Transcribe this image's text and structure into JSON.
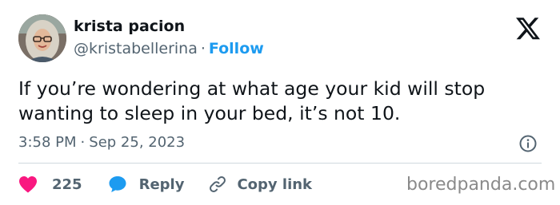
{
  "author": {
    "name": "krista pacion",
    "handle": "@kristabellerina",
    "follow_label": "Follow"
  },
  "tweet": {
    "text": "If you’re wondering at what age your kid will stop wanting to sleep in your bed, it’s not 10.",
    "time": "3:58 PM",
    "date": "Sep 25, 2023"
  },
  "actions": {
    "like_count": "225",
    "reply_label": "Reply",
    "copy_label": "Copy link"
  },
  "watermark": "boredpanda.com",
  "colors": {
    "accent": "#1d9bf0",
    "like": "#f91880",
    "text": "#0f1419",
    "secondary": "#536471"
  },
  "icons": [
    "x-logo-icon",
    "info-icon",
    "heart-icon",
    "reply-bubble-icon",
    "link-icon"
  ]
}
